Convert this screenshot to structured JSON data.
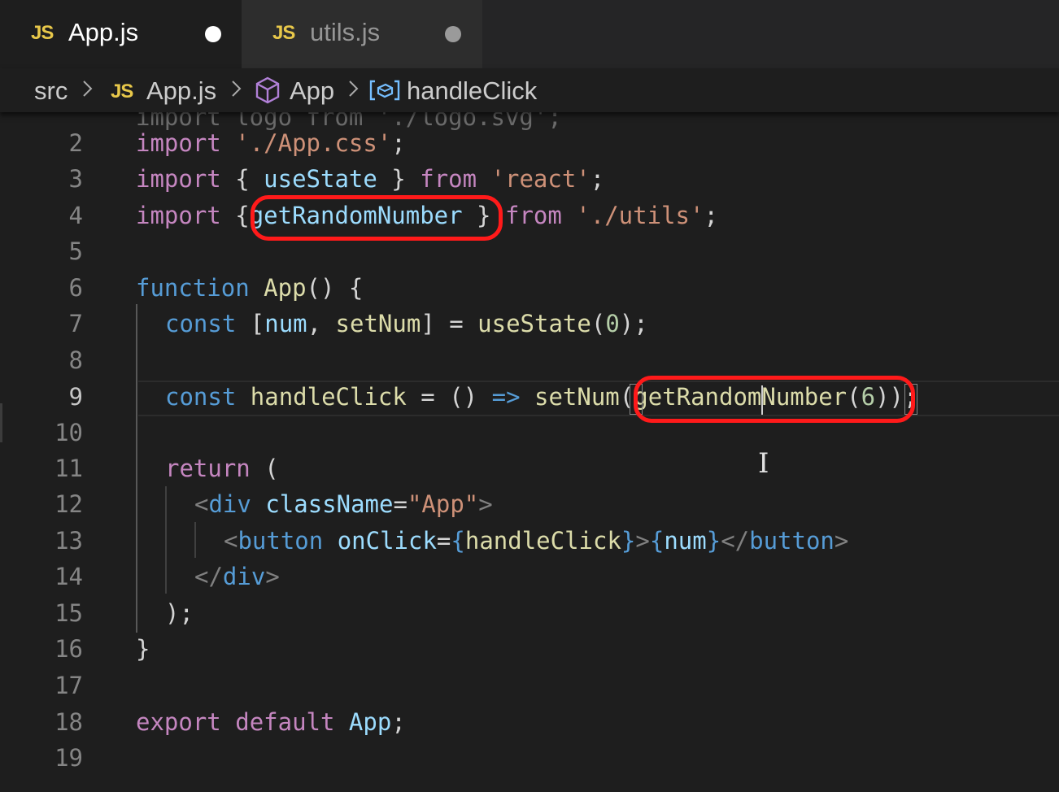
{
  "tabs": [
    {
      "icon": "JS",
      "label": "App.js",
      "state": "active, unsaved"
    },
    {
      "icon": "JS",
      "label": "utils.js",
      "state": "inactive, unsaved"
    }
  ],
  "breadcrumb": {
    "folder": "src",
    "file_icon": "JS",
    "file": "App.js",
    "component": "App",
    "symbol": "handleClick"
  },
  "editor": {
    "current_line": "9",
    "line_numbers": [
      "2",
      "3",
      "4",
      "5",
      "6",
      "7",
      "8",
      "9",
      "10",
      "11",
      "12",
      "13",
      "14",
      "15",
      "16",
      "17",
      "18",
      "19"
    ],
    "partial_line": "import logo from './logo.svg';",
    "tokens": {
      "l2": [
        "import",
        " ",
        "'./App.css'",
        ";"
      ],
      "l3": [
        "import",
        " { ",
        "useState",
        " } ",
        "from",
        " ",
        "'react'",
        ";"
      ],
      "l4": [
        "import",
        " {",
        "getRandomNumber",
        " } ",
        "from",
        " ",
        "'./utils'",
        ";"
      ],
      "l6": [
        "function",
        " ",
        "App",
        "() {"
      ],
      "l7": [
        "const",
        " [",
        "num",
        ", ",
        "setNum",
        "] = ",
        "useState",
        "(",
        "0",
        ");"
      ],
      "l9": [
        "const",
        " ",
        "handleClick",
        " = () ",
        "=>",
        " ",
        "setNum",
        "(",
        "getRandomNumber",
        "(",
        "6",
        ")",
        ")",
        ";"
      ],
      "l11": [
        "return",
        " ("
      ],
      "l12": [
        "<",
        "div",
        " ",
        "className",
        "=",
        "\"App\"",
        ">"
      ],
      "l13": [
        "<",
        "button",
        " ",
        "onClick",
        "=",
        "{",
        "handleClick",
        "}",
        ">",
        "{",
        "num",
        "}",
        "</",
        "button",
        ">"
      ],
      "l14": [
        "</",
        "div",
        ">"
      ],
      "l15": [
        ");"
      ],
      "l16": [
        "}"
      ],
      "l18": [
        "export",
        " ",
        "default",
        " ",
        "App",
        ";"
      ]
    }
  }
}
